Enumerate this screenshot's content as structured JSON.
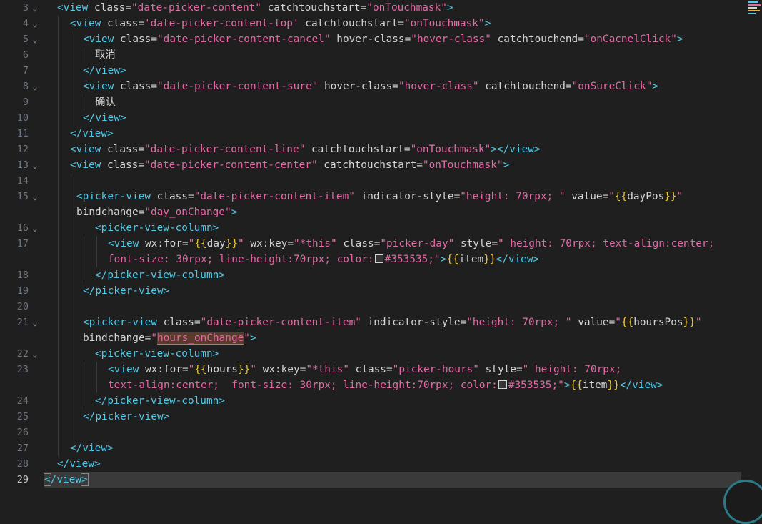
{
  "gutter": {
    "line_numbers": [
      "3",
      "4",
      "5",
      "6",
      "7",
      "8",
      "9",
      "10",
      "11",
      "12",
      "13",
      "14",
      "15",
      "16",
      "17",
      "18",
      "19",
      "20",
      "21",
      "22",
      "23",
      "24",
      "25",
      "26",
      "27",
      "28",
      "29"
    ],
    "current_line": "29"
  },
  "strings": {
    "view": "view",
    "picker_view": "picker-view",
    "picker_view_column": "picker-view-column",
    "class_attr": "class",
    "catchtouchstart": "catchtouchstart",
    "catchtouchend": "catchtouchend",
    "hover_class_attr": "hover-class",
    "indicator_style": "indicator-style",
    "value_attr": "value",
    "bindchange": "bindchange",
    "wx_for": "wx:for",
    "wx_key": "wx:key",
    "style_attr": "style",
    "cls_content": "date-picker-content",
    "cls_top": "date-picker-content-top",
    "cls_cancel": "date-picker-content-cancel",
    "cls_sure": "date-picker-content-sure",
    "cls_line": "date-picker-content-line",
    "cls_center": "date-picker-content-center",
    "cls_item": "date-picker-content-item",
    "cls_day": "picker-day",
    "cls_hours": "picker-hours",
    "hover_class_val": "hover-class",
    "on_touchmask": "onTouchmask",
    "on_cancel": "onCacnelClick",
    "on_sure": "onSureClick",
    "indicator_val": "height: 70rpx; ",
    "day_pos": "dayPos",
    "hours_pos": "hoursPos",
    "day_change": "day_onChange",
    "hours_change": "hours_onChange",
    "day": "day",
    "hours": "hours",
    "this_key": "*this",
    "item": "item",
    "style_day_1": " height: 70rpx; text-align:center;",
    "style_day_2": "font-size: 30rpx; line-height:70rpx; color:",
    "style_hours_1": " height: 70rpx;",
    "style_hours_2": "text-align:center;  font-size: 30rpx; line-height:70rpx; color:",
    "color_val": "#353535;",
    "text_cancel": "取消",
    "text_sure": "确认"
  },
  "colors": {
    "background": "#1f1f1f",
    "tag": "#4ec9e6",
    "attribute": "#d4d4d4",
    "string": "#e06ba5",
    "bracket": "#e8c63a",
    "line_number": "#6e7681",
    "current_line_bg": "#3a3a3a",
    "swatch": "#353535"
  }
}
